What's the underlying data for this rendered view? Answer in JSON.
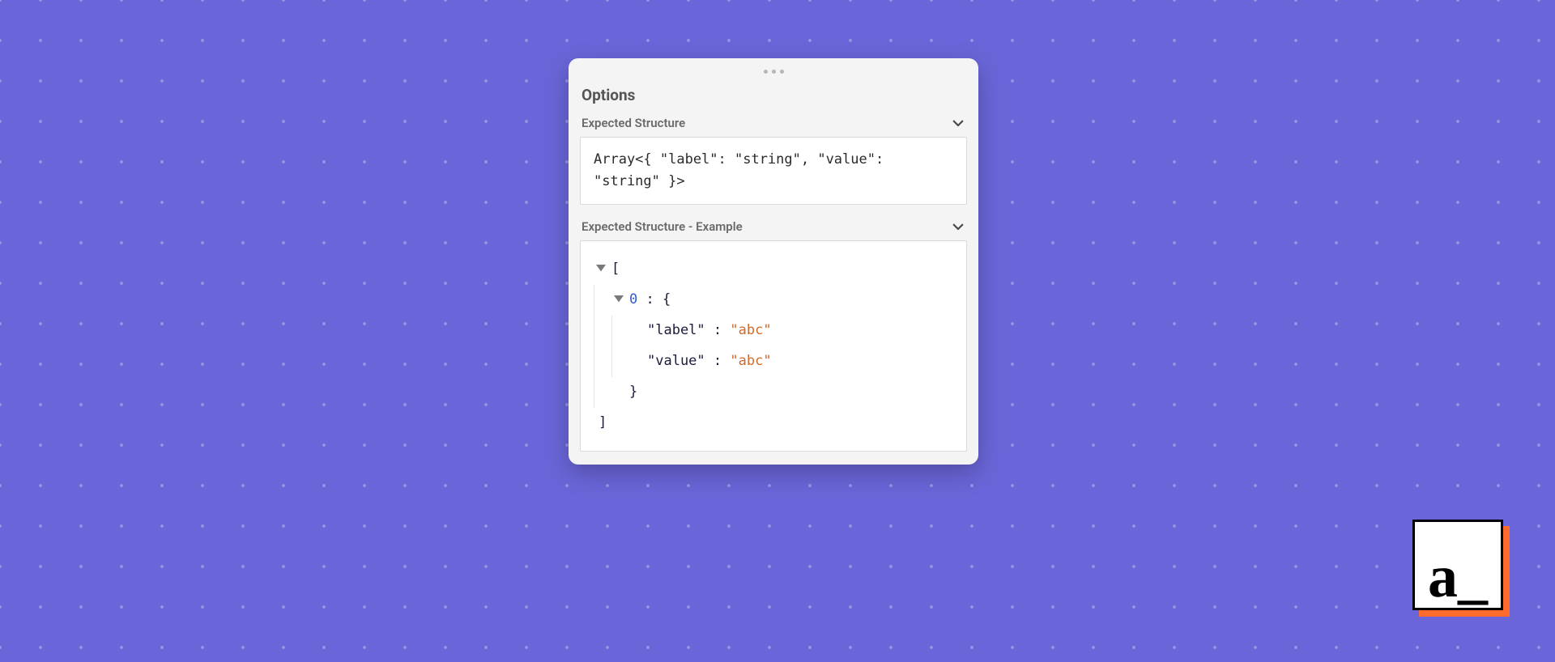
{
  "panel": {
    "title": "Options",
    "sections": {
      "structure": {
        "label": "Expected Structure",
        "code": "Array<{ \"label\": \"string\", \"value\": \"string\" }>"
      },
      "example": {
        "label": "Expected Structure - Example",
        "tree": {
          "open": "[",
          "close": "]",
          "index": "0",
          "item_open": "{",
          "item_close": "}",
          "colon": " : ",
          "props": [
            {
              "key": "\"label\"",
              "value": "\"abc\""
            },
            {
              "key": "\"value\"",
              "value": "\"abc\""
            }
          ]
        }
      }
    }
  },
  "logo": {
    "a": "a",
    "underscore": "_"
  }
}
